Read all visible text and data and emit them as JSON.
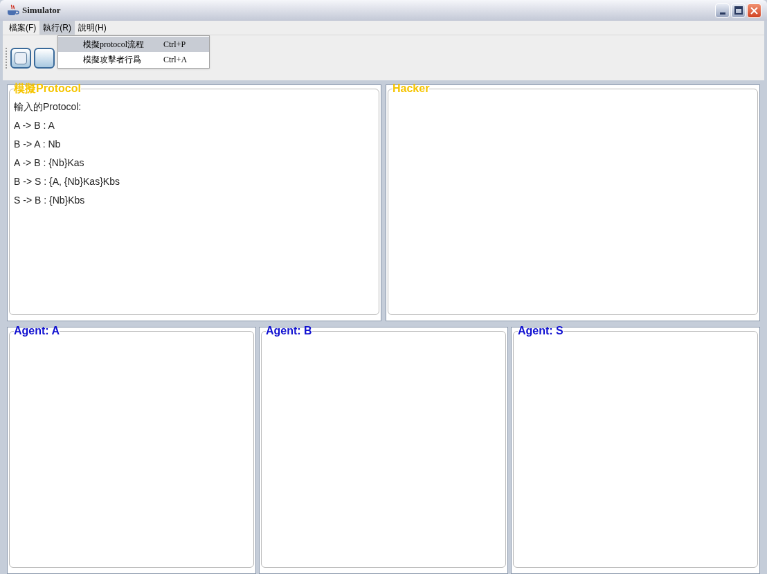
{
  "window": {
    "title": "Simulator"
  },
  "menu_bar": [
    {
      "label": "檔案(F)",
      "selected": false
    },
    {
      "label": "執行(R)",
      "selected": true
    },
    {
      "label": "說明(H)",
      "selected": false
    }
  ],
  "dropdown": [
    {
      "label": "模擬protocol流程",
      "shortcut": "Ctrl+P",
      "selected": true
    },
    {
      "label": "模擬攻擊者行爲",
      "shortcut": "Ctrl+A",
      "selected": false
    }
  ],
  "panels": [
    {
      "title": "模擬Protocol",
      "color": "#f5c400",
      "lines": [
        "輸入的Protocol:",
        "A -> B : A",
        "B -> A : Nb",
        "A -> B : {Nb}Kas",
        "B -> S : {A, {Nb}Kas}Kbs",
        "S -> B : {Nb}Kbs"
      ]
    },
    {
      "title": "Hacker",
      "color": "#f5c400"
    },
    {
      "title": "Agent: A",
      "color": "#1010d0"
    },
    {
      "title": "Agent: B",
      "color": "#1010d0"
    },
    {
      "title": "Agent: S",
      "color": "#1010d0"
    }
  ]
}
